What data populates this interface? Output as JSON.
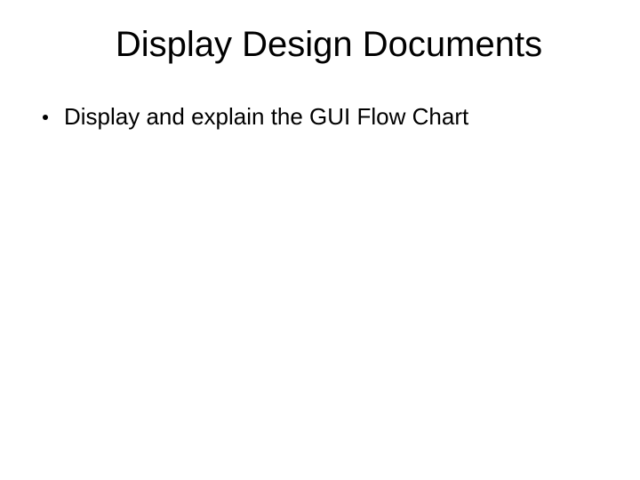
{
  "slide": {
    "title": "Display Design Documents",
    "bullets": [
      "Display and explain the GUI Flow Chart"
    ]
  }
}
